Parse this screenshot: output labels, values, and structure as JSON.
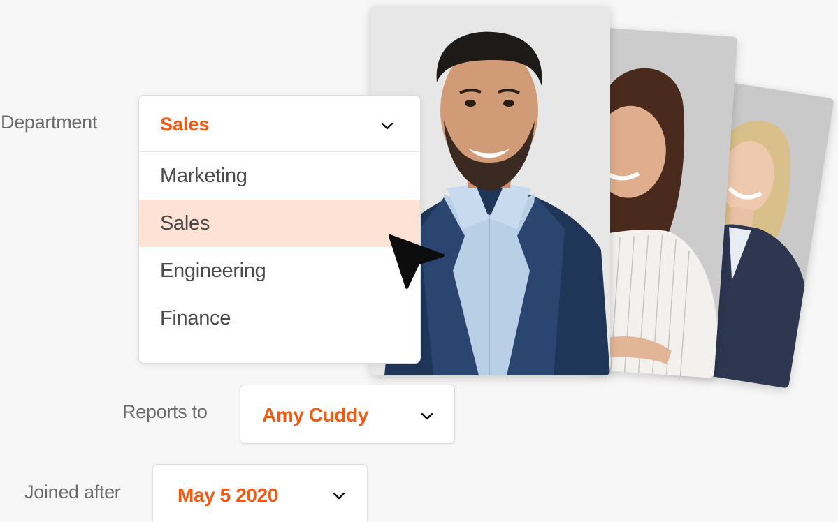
{
  "department": {
    "label": "Department",
    "selected": "Sales",
    "options": [
      "Marketing",
      "Sales",
      "Engineering",
      "Finance"
    ],
    "highlighted": "Sales"
  },
  "reports_to": {
    "label": "Reports to",
    "value": "Amy Cuddy"
  },
  "joined_after": {
    "label": "Joined after",
    "value": "May 5 2020"
  },
  "photos": [
    "person-photo-man",
    "person-photo-woman-brunette",
    "person-photo-woman-blonde"
  ],
  "colors": {
    "accent": "#f15a13",
    "highlight": "#fde2d5",
    "label": "#6b6b6b"
  },
  "icons": {
    "chevron": "chevron-down-icon",
    "cursor": "mouse-pointer-icon"
  }
}
